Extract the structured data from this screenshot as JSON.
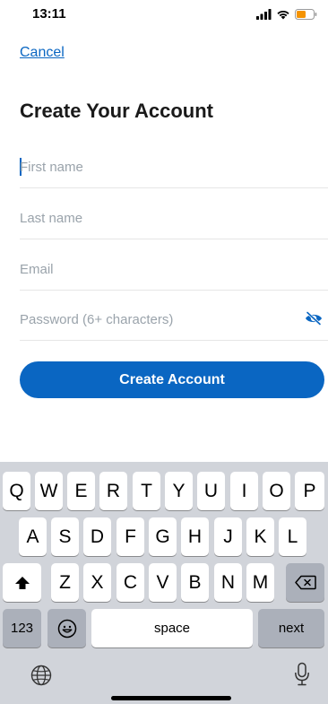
{
  "status_bar": {
    "time": "13:11",
    "signal_icon": "signal-bars-icon",
    "wifi_icon": "wifi-icon",
    "battery_icon": "battery-low-icon",
    "battery_color": "#f59300"
  },
  "header": {
    "cancel_label": "Cancel",
    "title": "Create Your Account"
  },
  "form": {
    "first_name_placeholder": "First name",
    "first_name_value": "",
    "last_name_placeholder": "Last name",
    "last_name_value": "",
    "email_placeholder": "Email",
    "email_value": "",
    "password_placeholder": "Password (6+ characters)",
    "password_value": "",
    "password_toggle_icon": "eye-slash-icon",
    "submit_label": "Create Account"
  },
  "colors": {
    "accent": "#0a66c2",
    "keyboard_bg": "#d1d4da"
  },
  "keyboard": {
    "row1": [
      "Q",
      "W",
      "E",
      "R",
      "T",
      "Y",
      "U",
      "I",
      "O",
      "P"
    ],
    "row2": [
      "A",
      "S",
      "D",
      "F",
      "G",
      "H",
      "J",
      "K",
      "L"
    ],
    "row3": [
      "Z",
      "X",
      "C",
      "V",
      "B",
      "N",
      "M"
    ],
    "numbers_label": "123",
    "space_label": "space",
    "next_label": "next",
    "shift_icon": "shift-icon",
    "delete_icon": "backspace-icon",
    "emoji_icon": "emoji-icon",
    "globe_icon": "globe-icon",
    "mic_icon": "microphone-icon"
  }
}
